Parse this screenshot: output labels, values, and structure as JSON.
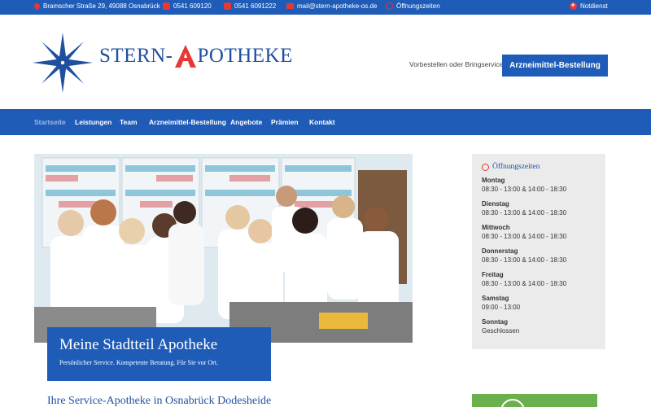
{
  "topbar": {
    "address": "Bramscher Straße 29, 49088 Osnabrück",
    "phone": "0541 609120",
    "fax": "0541 6091222",
    "email": "mail@stern-apotheke-os.de",
    "hours_link": "Öffnungszeiten",
    "emergency": "Notdienst"
  },
  "header": {
    "logo_text_left": "STERN-",
    "logo_text_right": "POTHEKE",
    "note": "Vorbestellen oder Bringservice",
    "order_button": "Arzneimittel-Bestellung"
  },
  "nav": {
    "items": [
      {
        "label": "Startseite"
      },
      {
        "label": "Leistungen"
      },
      {
        "label": "Team"
      },
      {
        "label": "Arzneimittel-Bestellung"
      },
      {
        "label": "Angebote"
      },
      {
        "label": "Prämien"
      },
      {
        "label": "Kontakt"
      }
    ]
  },
  "hero": {
    "title": "Meine Stadtteil Apotheke",
    "subtitle": "Persönlicher Service. Kompetente Beratung. Für Sie vor Ort."
  },
  "main": {
    "heading": "Ihre Service-Apotheke in Osnabrück Dodesheide"
  },
  "hours": {
    "title": "Öffnungszeiten",
    "days": [
      {
        "day": "Montag",
        "time": "08:30 - 13:00 & 14:00 - 18:30"
      },
      {
        "day": "Dienstag",
        "time": "08:30 - 13:00 & 14:00 - 18:30"
      },
      {
        "day": "Mittwoch",
        "time": "08:30 - 13:00 & 14:00 - 18:30"
      },
      {
        "day": "Donnerstag",
        "time": "08:30 - 13:00 & 14:00 - 18:30"
      },
      {
        "day": "Freitag",
        "time": "08:30 - 13:00 & 14:00 - 18:30"
      },
      {
        "day": "Samstag",
        "time": "09:00 - 13:00"
      },
      {
        "day": "Sonntag",
        "time": "Geschlossen"
      }
    ]
  },
  "colors": {
    "brand_blue": "#1f5cb8",
    "logo_blue": "#1f4fa0",
    "accent_red": "#e53935",
    "sidebar_bg": "#ebebeb",
    "green": "#6ab04c"
  }
}
